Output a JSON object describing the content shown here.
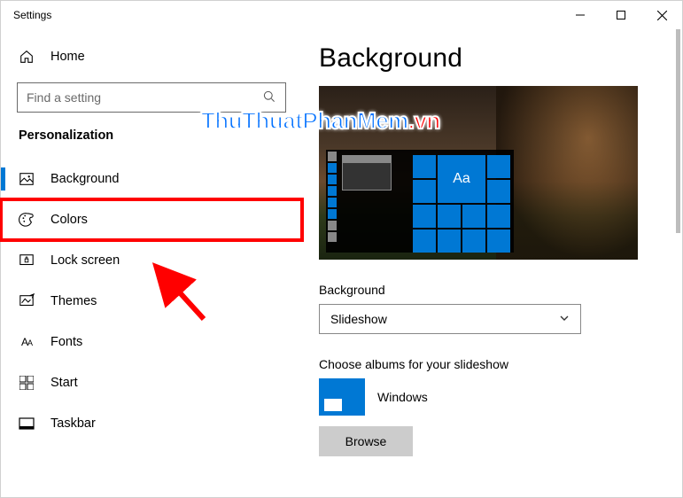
{
  "window": {
    "title": "Settings"
  },
  "sidebar": {
    "home": "Home",
    "search_placeholder": "Find a setting",
    "section": "Personalization",
    "items": [
      {
        "label": "Background"
      },
      {
        "label": "Colors"
      },
      {
        "label": "Lock screen"
      },
      {
        "label": "Themes"
      },
      {
        "label": "Fonts"
      },
      {
        "label": "Start"
      },
      {
        "label": "Taskbar"
      }
    ]
  },
  "main": {
    "title": "Background",
    "preview_tile_text": "Aa",
    "dropdown_label": "Background",
    "dropdown_value": "Slideshow",
    "albums_label": "Choose albums for your slideshow",
    "album_name": "Windows",
    "browse": "Browse"
  },
  "watermark": {
    "text": "ThuThuatPhanMem",
    "suffix": ".vn"
  }
}
